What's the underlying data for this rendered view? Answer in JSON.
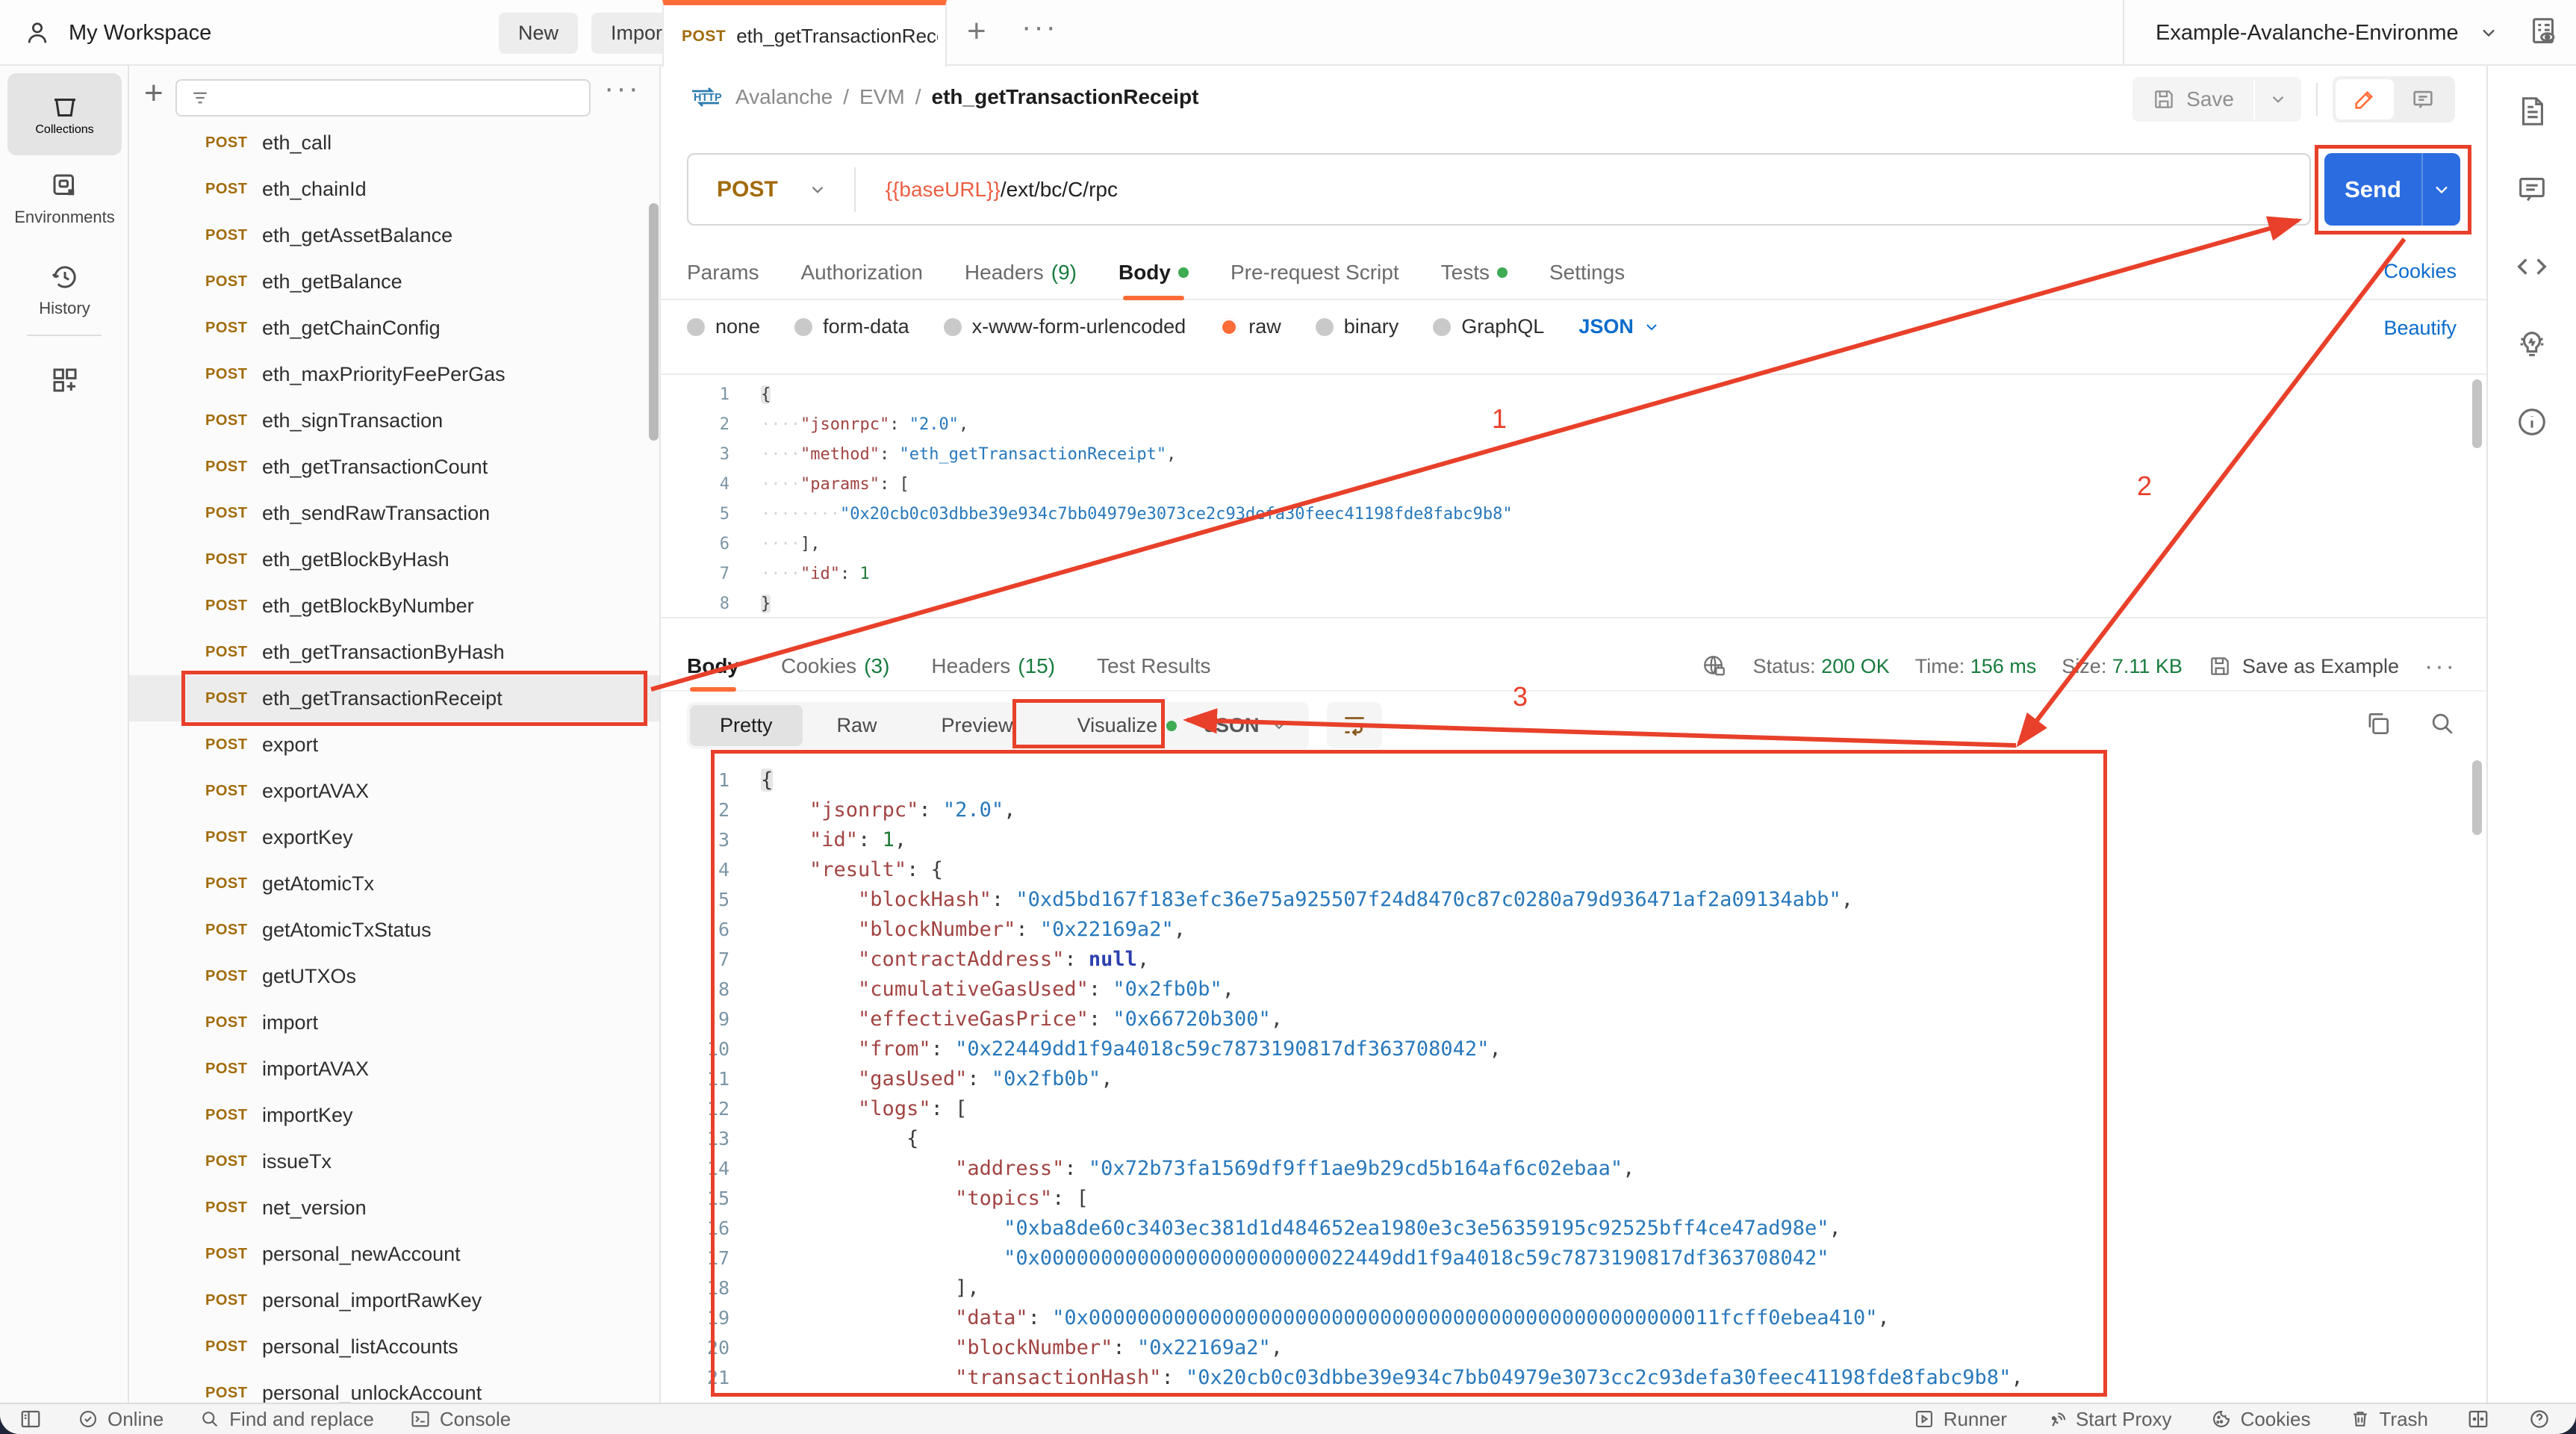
{
  "colors": {
    "accent_orange": "#ff6c37",
    "send_blue": "#2b6ce0",
    "link_blue": "#0b6bcb",
    "ok_green": "#177c3d",
    "method_gold": "#a16b0b",
    "annotation_red": "#e8402a"
  },
  "topbar": {
    "workspace": "My Workspace",
    "new_label": "New",
    "import_label": "Import",
    "tab": {
      "method": "POST",
      "title": "eth_getTransactionRece"
    },
    "environment": "Example-Avalanche-Environme"
  },
  "rail": {
    "collections": "Collections",
    "environments": "Environments",
    "history": "History"
  },
  "sidebar": {
    "method_label": "POST",
    "selected_index": 12,
    "items": [
      "eth_call",
      "eth_chainId",
      "eth_getAssetBalance",
      "eth_getBalance",
      "eth_getChainConfig",
      "eth_maxPriorityFeePerGas",
      "eth_signTransaction",
      "eth_getTransactionCount",
      "eth_sendRawTransaction",
      "eth_getBlockByHash",
      "eth_getBlockByNumber",
      "eth_getTransactionByHash",
      "eth_getTransactionReceipt",
      "export",
      "exportAVAX",
      "exportKey",
      "getAtomicTx",
      "getAtomicTxStatus",
      "getUTXOs",
      "import",
      "importAVAX",
      "importKey",
      "issueTx",
      "net_version",
      "personal_newAccount",
      "personal_importRawKey",
      "personal_listAccounts",
      "personal_unlockAccount"
    ]
  },
  "request": {
    "breadcrumb": [
      "Avalanche",
      "EVM",
      "eth_getTransactionReceipt"
    ],
    "save_label": "Save",
    "method": "POST",
    "url_variable": "{{baseURL}}",
    "url_path": "/ext/bc/C/rpc",
    "send_label": "Send",
    "cookies_link": "Cookies",
    "beautify_link": "Beautify",
    "language": "JSON",
    "tabs": [
      {
        "label": "Params"
      },
      {
        "label": "Authorization"
      },
      {
        "label": "Headers",
        "count": "(9)"
      },
      {
        "label": "Body",
        "dot": true,
        "active": true
      },
      {
        "label": "Pre-request Script"
      },
      {
        "label": "Tests",
        "dot": true
      },
      {
        "label": "Settings"
      }
    ],
    "body_modes": [
      {
        "label": "none"
      },
      {
        "label": "form-data"
      },
      {
        "label": "x-www-form-urlencoded"
      },
      {
        "label": "raw",
        "selected": true
      },
      {
        "label": "binary"
      },
      {
        "label": "GraphQL"
      }
    ],
    "code_lines": [
      [
        [
          "b",
          "{"
        ]
      ],
      [
        [
          "g",
          "    "
        ],
        [
          "k",
          "\"jsonrpc\""
        ],
        [
          "p",
          ": "
        ],
        [
          "s",
          "\"2.0\""
        ],
        [
          "p",
          ","
        ]
      ],
      [
        [
          "g",
          "    "
        ],
        [
          "k",
          "\"method\""
        ],
        [
          "p",
          ": "
        ],
        [
          "s",
          "\"eth_getTransactionReceipt\""
        ],
        [
          "p",
          ","
        ]
      ],
      [
        [
          "g",
          "    "
        ],
        [
          "k",
          "\"params\""
        ],
        [
          "p",
          ": ["
        ]
      ],
      [
        [
          "g",
          "        "
        ],
        [
          "s",
          "\"0x20cb0c03dbbe39e934c7bb04979e3073ce2c93defa30feec41198fde8fabc9b8\""
        ]
      ],
      [
        [
          "g",
          "    "
        ],
        [
          "p",
          "],"
        ]
      ],
      [
        [
          "g",
          "    "
        ],
        [
          "k",
          "\"id\""
        ],
        [
          "p",
          ": "
        ],
        [
          "n",
          "1"
        ]
      ],
      [
        [
          "b",
          "}"
        ]
      ]
    ]
  },
  "response": {
    "tabs": [
      {
        "label": "Body",
        "active": true
      },
      {
        "label": "Cookies",
        "count": "(3)"
      },
      {
        "label": "Headers",
        "count": "(15)"
      },
      {
        "label": "Test Results"
      }
    ],
    "status_label": "Status:",
    "status_value": "200 OK",
    "time_label": "Time:",
    "time_value": "156 ms",
    "size_label": "Size:",
    "size_value": "7.11 KB",
    "save_as_example": "Save as Example",
    "language": "JSON",
    "views": [
      {
        "label": "Pretty",
        "active": true
      },
      {
        "label": "Raw"
      },
      {
        "label": "Preview"
      },
      {
        "label": "Visualize",
        "dot": true
      }
    ],
    "code_lines": [
      [
        [
          "b",
          "{"
        ]
      ],
      [
        [
          "g",
          "    "
        ],
        [
          "k",
          "\"jsonrpc\""
        ],
        [
          "p",
          ": "
        ],
        [
          "s",
          "\"2.0\""
        ],
        [
          "p",
          ","
        ]
      ],
      [
        [
          "g",
          "    "
        ],
        [
          "k",
          "\"id\""
        ],
        [
          "p",
          ": "
        ],
        [
          "n",
          "1"
        ],
        [
          "p",
          ","
        ]
      ],
      [
        [
          "g",
          "    "
        ],
        [
          "k",
          "\"result\""
        ],
        [
          "p",
          ": {"
        ]
      ],
      [
        [
          "g",
          "        "
        ],
        [
          "k",
          "\"blockHash\""
        ],
        [
          "p",
          ": "
        ],
        [
          "s",
          "\"0xd5bd167f183efc36e75a925507f24d8470c87c0280a79d936471af2a09134abb\""
        ],
        [
          "p",
          ","
        ]
      ],
      [
        [
          "g",
          "        "
        ],
        [
          "k",
          "\"blockNumber\""
        ],
        [
          "p",
          ": "
        ],
        [
          "s",
          "\"0x22169a2\""
        ],
        [
          "p",
          ","
        ]
      ],
      [
        [
          "g",
          "        "
        ],
        [
          "k",
          "\"contractAddress\""
        ],
        [
          "p",
          ": "
        ],
        [
          "u",
          "null"
        ],
        [
          "p",
          ","
        ]
      ],
      [
        [
          "g",
          "        "
        ],
        [
          "k",
          "\"cumulativeGasUsed\""
        ],
        [
          "p",
          ": "
        ],
        [
          "s",
          "\"0x2fb0b\""
        ],
        [
          "p",
          ","
        ]
      ],
      [
        [
          "g",
          "        "
        ],
        [
          "k",
          "\"effectiveGasPrice\""
        ],
        [
          "p",
          ": "
        ],
        [
          "s",
          "\"0x66720b300\""
        ],
        [
          "p",
          ","
        ]
      ],
      [
        [
          "g",
          "        "
        ],
        [
          "k",
          "\"from\""
        ],
        [
          "p",
          ": "
        ],
        [
          "s",
          "\"0x22449dd1f9a4018c59c7873190817df363708042\""
        ],
        [
          "p",
          ","
        ]
      ],
      [
        [
          "g",
          "        "
        ],
        [
          "k",
          "\"gasUsed\""
        ],
        [
          "p",
          ": "
        ],
        [
          "s",
          "\"0x2fb0b\""
        ],
        [
          "p",
          ","
        ]
      ],
      [
        [
          "g",
          "        "
        ],
        [
          "k",
          "\"logs\""
        ],
        [
          "p",
          ": ["
        ]
      ],
      [
        [
          "g",
          "            "
        ],
        [
          "p",
          "{"
        ]
      ],
      [
        [
          "g",
          "                "
        ],
        [
          "k",
          "\"address\""
        ],
        [
          "p",
          ": "
        ],
        [
          "s",
          "\"0x72b73fa1569df9ff1ae9b29cd5b164af6c02ebaa\""
        ],
        [
          "p",
          ","
        ]
      ],
      [
        [
          "g",
          "                "
        ],
        [
          "k",
          "\"topics\""
        ],
        [
          "p",
          ": ["
        ]
      ],
      [
        [
          "g",
          "                    "
        ],
        [
          "s",
          "\"0xba8de60c3403ec381d1d484652ea1980e3c3e56359195c92525bff4ce47ad98e\""
        ],
        [
          "p",
          ","
        ]
      ],
      [
        [
          "g",
          "                    "
        ],
        [
          "s",
          "\"0x00000000000000000000000022449dd1f9a4018c59c7873190817df363708042\""
        ]
      ],
      [
        [
          "g",
          "                "
        ],
        [
          "p",
          "],"
        ]
      ],
      [
        [
          "g",
          "                "
        ],
        [
          "k",
          "\"data\""
        ],
        [
          "p",
          ": "
        ],
        [
          "s",
          "\"0x0000000000000000000000000000000000000000000000000011fcff0ebea410\""
        ],
        [
          "p",
          ","
        ]
      ],
      [
        [
          "g",
          "                "
        ],
        [
          "k",
          "\"blockNumber\""
        ],
        [
          "p",
          ": "
        ],
        [
          "s",
          "\"0x22169a2\""
        ],
        [
          "p",
          ","
        ]
      ],
      [
        [
          "g",
          "                "
        ],
        [
          "k",
          "\"transactionHash\""
        ],
        [
          "p",
          ": "
        ],
        [
          "s",
          "\"0x20cb0c03dbbe39e934c7bb04979e3073cc2c93defa30feec41198fde8fabc9b8\""
        ],
        [
          "p",
          ","
        ]
      ]
    ]
  },
  "statusbar": {
    "online": "Online",
    "find": "Find and replace",
    "console": "Console",
    "runner": "Runner",
    "proxy": "Start Proxy",
    "cookies": "Cookies",
    "trash": "Trash"
  },
  "annotations": {
    "n1": "1",
    "n2": "2",
    "n3": "3"
  }
}
